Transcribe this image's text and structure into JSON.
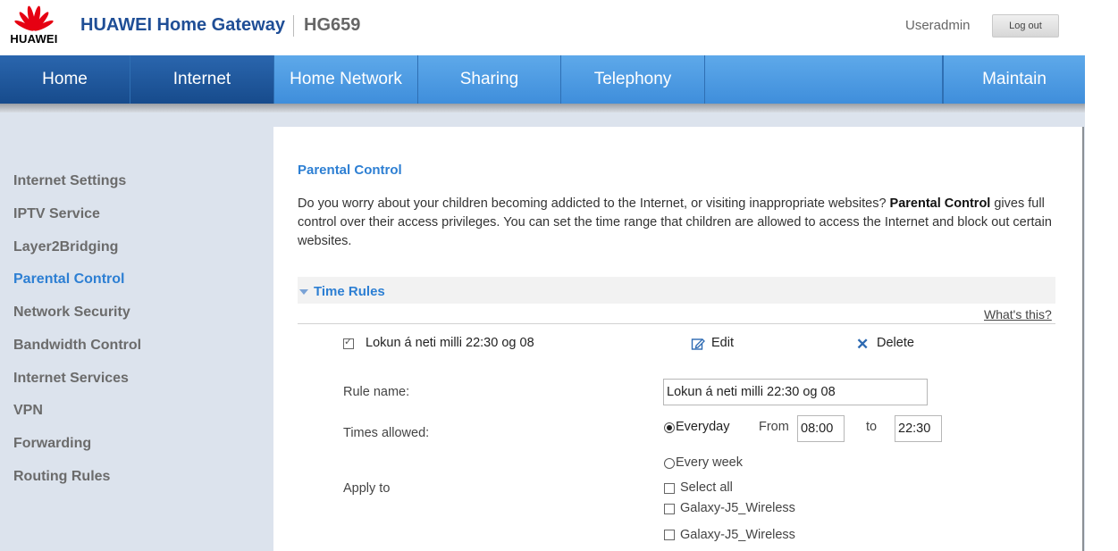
{
  "header": {
    "logo_text": "HUAWEI",
    "app_title": "HUAWEI Home Gateway",
    "model": "HG659",
    "user": "Useradmin",
    "logout_label": "Log out",
    "brand_color": "#e60012"
  },
  "nav": {
    "items": [
      {
        "label": "Home"
      },
      {
        "label": "Internet"
      },
      {
        "label": "Home Network"
      },
      {
        "label": "Sharing"
      },
      {
        "label": "Telephony"
      },
      {
        "label": "Maintain"
      }
    ],
    "active": "Internet"
  },
  "sidebar": {
    "items": [
      {
        "label": "Internet Settings"
      },
      {
        "label": "IPTV Service"
      },
      {
        "label": "Layer2Bridging"
      },
      {
        "label": "Parental Control"
      },
      {
        "label": "Network Security"
      },
      {
        "label": "Bandwidth Control"
      },
      {
        "label": "Internet Services"
      },
      {
        "label": "VPN"
      },
      {
        "label": "Forwarding"
      },
      {
        "label": "Routing Rules"
      }
    ],
    "active": "Parental Control"
  },
  "main": {
    "title": "Parental Control",
    "desc_part1": "Do you worry about your children becoming addicted to the Internet, or visiting inappropriate websites? ",
    "desc_bold": "Parental Control",
    "desc_part2": " gives full control over their access privileges. You can set the time range that children are allowed to access the Internet and block out certain websites.",
    "section_title": "Time Rules",
    "whats_this": "What's this?",
    "rule": {
      "name": "Lokun á neti milli 22:30 og 08",
      "checked": true,
      "edit_label": "Edit",
      "delete_label": "Delete"
    },
    "form": {
      "rule_name_label": "Rule name:",
      "rule_name_value": "Lokun á neti milli 22:30 og 08",
      "times_label": "Times allowed:",
      "everyday_label": "Everyday",
      "from_label": "From",
      "from_value": "08:00",
      "to_label": "to",
      "to_value": "22:30",
      "every_week_label": "Every week",
      "apply_label": "Apply to",
      "select_all_label": "Select all",
      "devices": [
        "Galaxy-J5_Wireless",
        "Galaxy-J5_Wireless"
      ]
    }
  },
  "colors": {
    "nav_blue": "#4a9be2",
    "nav_dark": "#1f559a",
    "accent": "#2d7fd3",
    "sidebar_bg": "#dce3ed"
  }
}
